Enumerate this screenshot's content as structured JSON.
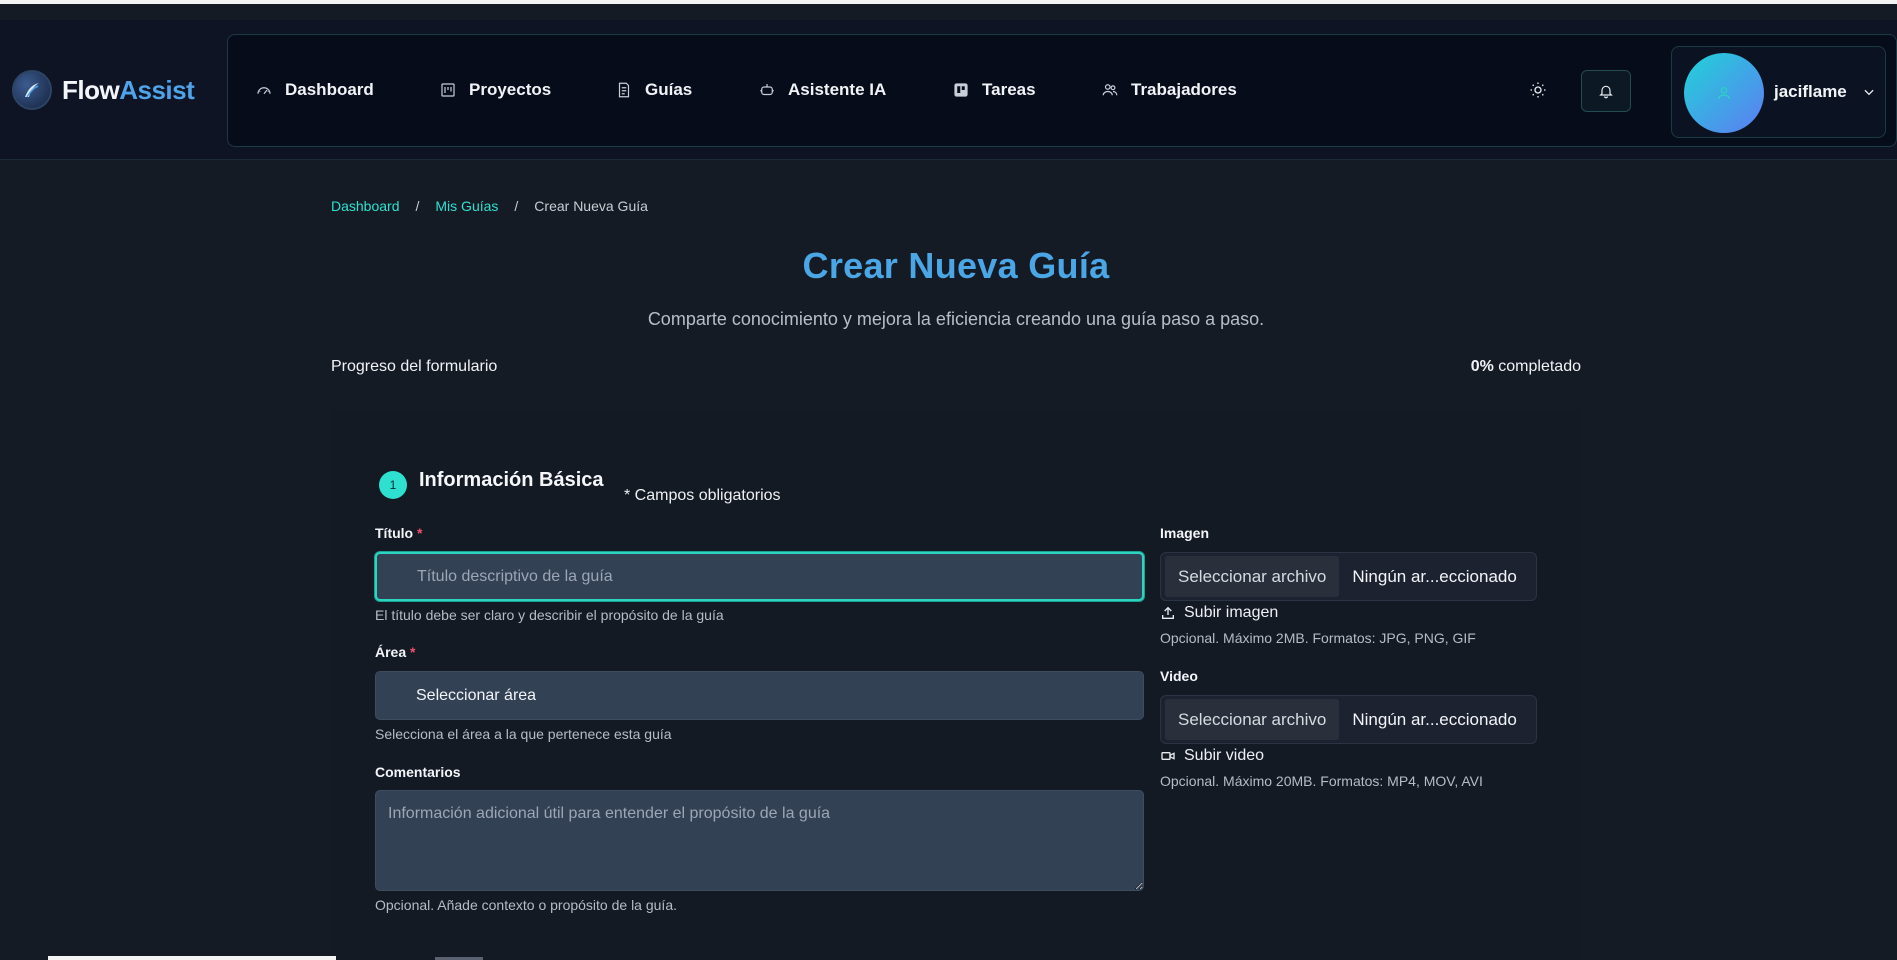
{
  "brand": {
    "name_part1": "Flow",
    "name_part2": "Assist",
    "logo_icon": "wave-logo-icon"
  },
  "nav": {
    "items": [
      {
        "label": "Dashboard",
        "icon": "gauge-icon"
      },
      {
        "label": "Proyectos",
        "icon": "kanban-icon"
      },
      {
        "label": "Guías",
        "icon": "document-icon"
      },
      {
        "label": "Asistente IA",
        "icon": "robot-icon"
      },
      {
        "label": "Tareas",
        "icon": "trello-icon"
      },
      {
        "label": "Trabajadores",
        "icon": "users-icon"
      }
    ],
    "theme_icon": "sun-icon",
    "notifications_icon": "bell-icon"
  },
  "user": {
    "username": "jaciflame",
    "avatar_icon": "user-icon",
    "menu_icon": "chevron-down-icon"
  },
  "breadcrumb": {
    "items": [
      "Dashboard",
      "Mis Guías",
      "Crear Nueva Guía"
    ],
    "separator": "/"
  },
  "header": {
    "title": "Crear Nueva Guía",
    "subtitle": "Comparte conocimiento y mejora la eficiencia creando una guía paso a paso."
  },
  "progress": {
    "label": "Progreso del formulario",
    "percent_text": "0%",
    "suffix": "completado",
    "value": 0
  },
  "section": {
    "number": "1",
    "title": "Información Básica",
    "required_note": "* Campos obligatorios"
  },
  "form": {
    "titulo": {
      "label": "Título",
      "required_mark": "*",
      "placeholder": "Título descriptivo de la guía",
      "value": "",
      "help": "El título debe ser claro y describir el propósito de la guía"
    },
    "area": {
      "label": "Área",
      "required_mark": "*",
      "selected": "Seleccionar área",
      "help": "Selecciona el área a la que pertenece esta guía"
    },
    "comentarios": {
      "label": "Comentarios",
      "placeholder": "Información adicional útil para entender el propósito de la guía",
      "help": "Opcional. Añade contexto o propósito de la guía."
    },
    "imagen": {
      "label": "Imagen",
      "button": "Seleccionar archivo",
      "file_name": "Ningún ar...eccionado",
      "upload_label": "Subir imagen",
      "help": "Opcional. Máximo 2MB. Formatos: JPG, PNG, GIF"
    },
    "video": {
      "label": "Video",
      "button": "Seleccionar archivo",
      "file_name": "Ningún ar...eccionado",
      "upload_label": "Subir video",
      "help": "Opcional. Máximo 20MB. Formatos: MP4, MOV, AVI"
    }
  },
  "colors": {
    "accent": "#2dd4bf",
    "brand_blue": "#4aa6e4",
    "required": "#f0506e",
    "background": "#151b25"
  }
}
